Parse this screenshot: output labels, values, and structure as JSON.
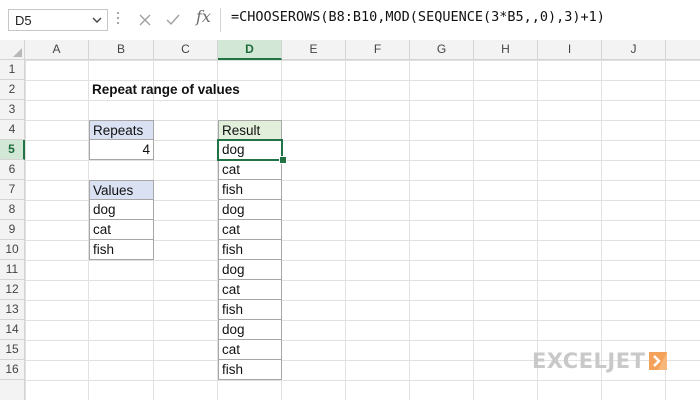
{
  "formula_bar": {
    "name_box": "D5",
    "fx_label": "fx",
    "formula": "=CHOOSEROWS(B8:B10,MOD(SEQUENCE(3*B5,,0),3)+1)"
  },
  "columns": [
    "A",
    "B",
    "C",
    "D",
    "E",
    "F",
    "G",
    "H",
    "I",
    "J"
  ],
  "rows": [
    "1",
    "2",
    "3",
    "4",
    "5",
    "6",
    "7",
    "8",
    "9",
    "10",
    "11",
    "12",
    "13",
    "14",
    "15",
    "16"
  ],
  "active_cell": {
    "column": "D",
    "row": "5"
  },
  "sheet": {
    "title": "Repeat range of values",
    "repeats_label": "Repeats",
    "repeats_value": "4",
    "values_label": "Values",
    "values": [
      "dog",
      "cat",
      "fish"
    ],
    "result_label": "Result",
    "results": [
      "dog",
      "cat",
      "fish",
      "dog",
      "cat",
      "fish",
      "dog",
      "cat",
      "fish",
      "dog",
      "cat",
      "fish"
    ]
  },
  "colors": {
    "accent": "#217346",
    "blue_header": "#d9e1f2",
    "green_header": "#e2efda",
    "logo_orange": "#f4a259"
  },
  "watermark": {
    "text": "EXCELJET"
  }
}
